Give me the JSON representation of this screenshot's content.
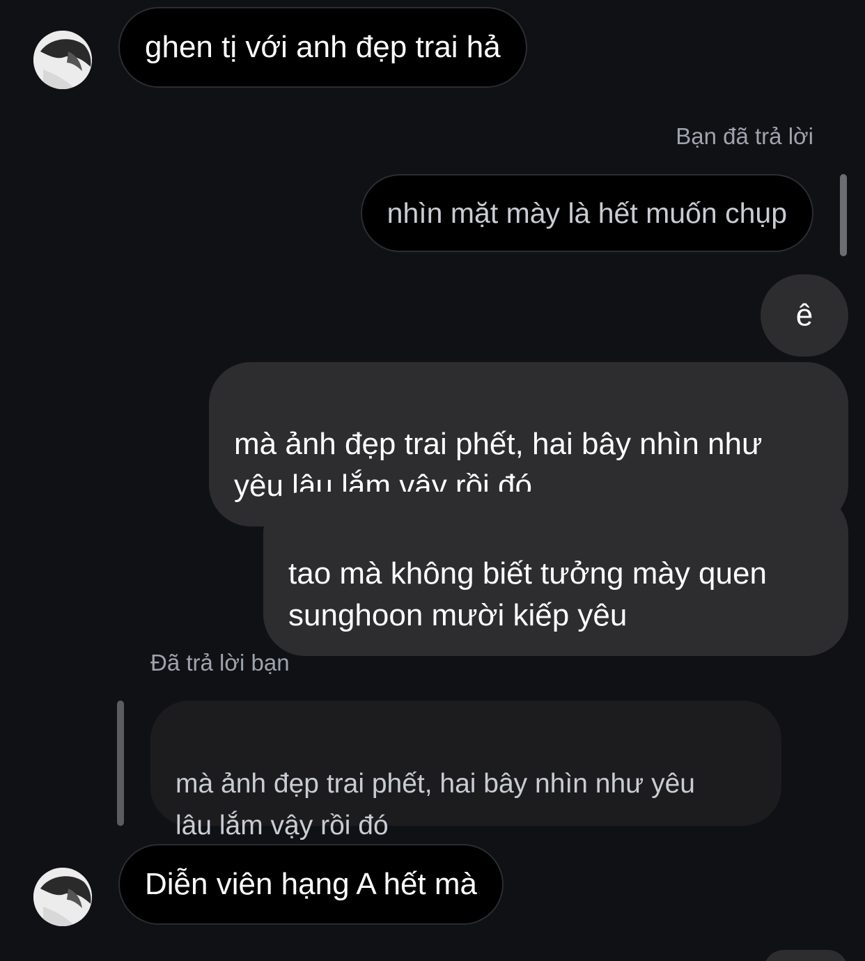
{
  "chat": {
    "messages": [
      {
        "sender": "them",
        "text": "ghen tị với anh đẹp trai hả"
      },
      {
        "sender": "me",
        "meta": "Bạn đã trả lời",
        "text": "nhìn mặt mày là hết muốn chụp"
      },
      {
        "sender": "me",
        "text": "ê"
      },
      {
        "sender": "me",
        "text": "mà ảnh đẹp trai phết, hai bây nhìn như\nyêu lâu lắm vậy rồi đó"
      },
      {
        "sender": "me",
        "text": "tao mà không biết tưởng mày quen\nsunghoon mười kiếp yêu"
      },
      {
        "sender": "them",
        "meta": "Đã trả lời bạn",
        "quoted": "mà ảnh đẹp trai phết, hai bây nhìn như yêu\nlâu lắm vậy rồi đó",
        "text": "Diễn viên hạng A hết mà"
      }
    ]
  },
  "icons": {
    "avatar": "profile-photo-icon"
  },
  "colors": {
    "background": "#0f1115",
    "bubble_outgoing": "#2d2d2f",
    "bubble_incoming": "#000000",
    "quote_background": "#1c1c1e",
    "meta_text": "#9ea3ad"
  }
}
